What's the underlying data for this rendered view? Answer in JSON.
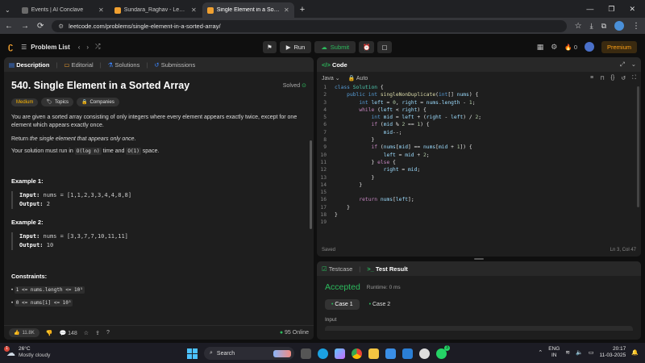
{
  "browser": {
    "tabs": [
      {
        "title": "Events | AI Conclave",
        "color": "#6a6a6a",
        "active": false
      },
      {
        "title": "Sundara_Raghav - LeetCode Pr",
        "color": "#f0a030",
        "active": false
      },
      {
        "title": "Single Element in a Sorted Arra",
        "color": "#f0a030",
        "active": true
      }
    ],
    "new_tab": "+",
    "url": "leetcode.com/problems/single-element-in-a-sorted-array/"
  },
  "header": {
    "problem_list": "Problem List",
    "run": "Run",
    "submit": "Submit",
    "streak": "0",
    "premium": "Premium"
  },
  "left_tabs": [
    "Description",
    "Editorial",
    "Solutions",
    "Submissions"
  ],
  "problem": {
    "title": "540. Single Element in a Sorted Array",
    "solved": "Solved",
    "difficulty": "Medium",
    "topics": "Topics",
    "companies": "Companies",
    "desc1": "You are given a sorted array consisting of only integers where every element appears exactly twice, except for one element which appears exactly once.",
    "desc2_prefix": "Return ",
    "desc2_em": "the single element that appears only once",
    "desc2_suffix": ".",
    "desc3_prefix": "Your solution must run in ",
    "desc3_code1": "O(log n)",
    "desc3_mid": " time and ",
    "desc3_code2": "O(1)",
    "desc3_suffix": " space.",
    "ex1_title": "Example 1:",
    "ex1_input_label": "Input:",
    "ex1_input": " nums = [1,1,2,3,3,4,4,8,8]",
    "ex1_output_label": "Output:",
    "ex1_output": " 2",
    "ex2_title": "Example 2:",
    "ex2_input_label": "Input:",
    "ex2_input": " nums = [3,3,7,7,10,11,11]",
    "ex2_output_label": "Output:",
    "ex2_output": " 10",
    "constraints_title": "Constraints:",
    "c1": "1 <= nums.length <= 10⁵",
    "c2": "0 <= nums[i] <= 10⁵",
    "likes": "11.8K",
    "comments": "148",
    "online": "95 Online"
  },
  "code": {
    "tab": "Code",
    "language": "Java",
    "auto": "Auto",
    "saved": "Saved",
    "cursor": "Ln 3, Col 47",
    "line_numbers": [
      "1",
      "2",
      "3",
      "4",
      "5",
      "6",
      "7",
      "8",
      "9",
      "10",
      "11",
      "12",
      "13",
      "14",
      "15",
      "16",
      "17",
      "18",
      "19"
    ]
  },
  "result": {
    "tabs": [
      "Testcase",
      "Test Result"
    ],
    "status": "Accepted",
    "runtime": "Runtime: 0 ms",
    "case1": "Case 1",
    "case2": "Case 2",
    "input_label": "Input"
  },
  "taskbar": {
    "temp": "26°C",
    "weather": "Mostly cloudy",
    "search": "Search",
    "lang1": "ENG",
    "lang2": "IN",
    "time": "20:17",
    "date": "11-03-2025",
    "weather_badge": "1",
    "app_badge": "3"
  }
}
